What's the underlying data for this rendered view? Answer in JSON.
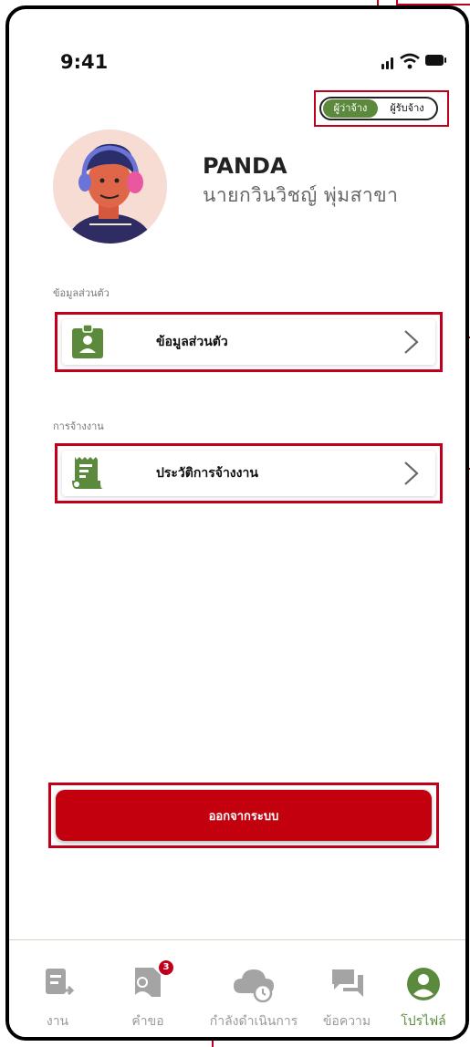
{
  "status_bar": {
    "time": "9:41"
  },
  "role_toggle": {
    "active": "ผู้ว่าจ้าง",
    "inactive": "ผู้รับจ้าง"
  },
  "profile": {
    "nickname": "PANDA",
    "full_name": "นายกวินวิชญ์  พุ่มสาขา"
  },
  "sections": {
    "personal": {
      "heading": "ข้อมูลส่วนตัว",
      "item_label": "ข้อมูลส่วนตัว",
      "icon": "id-badge-icon"
    },
    "employment": {
      "heading": "การจ้างงาน",
      "item_label": "ประวัติการจ้างงาน",
      "icon": "receipt-icon"
    }
  },
  "logout_label": "ออกจากระบบ",
  "tabs": [
    {
      "label": "งาน",
      "icon": "job-icon"
    },
    {
      "label": "คำขอ",
      "icon": "request-icon",
      "badge": "3"
    },
    {
      "label": "กำลังดำเนินการ",
      "icon": "cloud-clock-icon"
    },
    {
      "label": "ข้อความ",
      "icon": "chat-icon"
    },
    {
      "label": "โปรไฟล์",
      "icon": "profile-icon",
      "active": true
    }
  ],
  "colors": {
    "accent_green": "#5b8a3c",
    "danger_red": "#c3000e",
    "annotation_red": "#c0001a"
  }
}
